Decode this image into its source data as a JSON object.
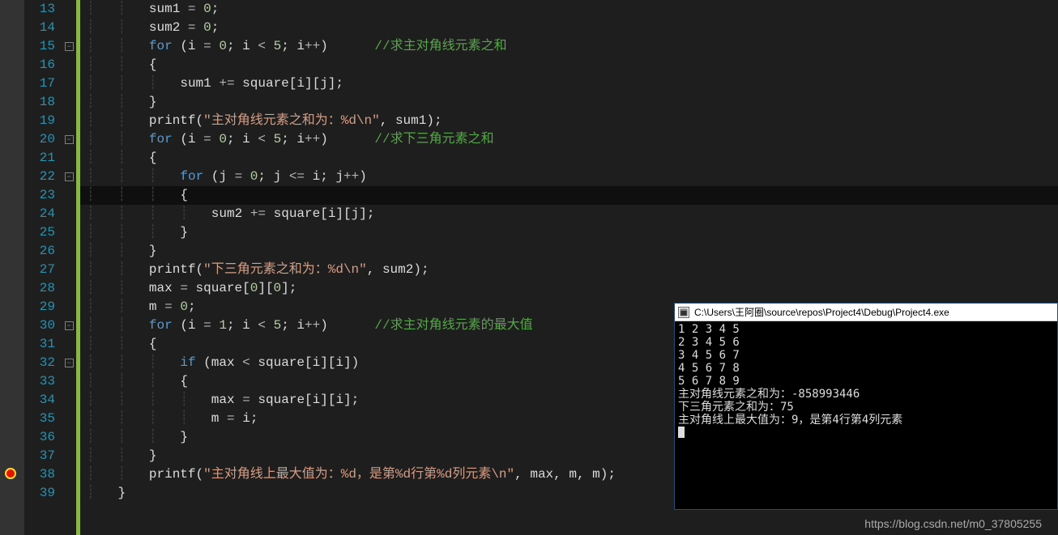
{
  "editor": {
    "lines": [
      {
        "num": 13,
        "fold": "",
        "html": "        sum1 <span class='op'>=</span> <span class='num'>0</span>;"
      },
      {
        "num": 14,
        "fold": "",
        "html": "        sum2 <span class='op'>=</span> <span class='num'>0</span>;"
      },
      {
        "num": 15,
        "fold": "box",
        "html": "        <span class='kw'>for</span> (i <span class='op'>=</span> <span class='num'>0</span>; i <span class='op'>&lt;</span> <span class='num'>5</span>; i<span class='op'>++</span>)      <span class='cmt'>//求主对角线元素之和</span>"
      },
      {
        "num": 16,
        "fold": "",
        "html": "        {"
      },
      {
        "num": 17,
        "fold": "",
        "html": "            sum1 <span class='op'>+=</span> square[i][j];"
      },
      {
        "num": 18,
        "fold": "",
        "html": "        }"
      },
      {
        "num": 19,
        "fold": "",
        "html": "        printf(<span class='str'>\"主对角线元素之和为：%d\\n\"</span>, sum1);"
      },
      {
        "num": 20,
        "fold": "box",
        "html": "        <span class='kw'>for</span> (i <span class='op'>=</span> <span class='num'>0</span>; i <span class='op'>&lt;</span> <span class='num'>5</span>; i<span class='op'>++</span>)      <span class='cmt'>//求下三角元素之和</span>"
      },
      {
        "num": 21,
        "fold": "",
        "html": "        {"
      },
      {
        "num": 22,
        "fold": "box",
        "html": "            <span class='kw'>for</span> (j <span class='op'>=</span> <span class='num'>0</span>; j <span class='op'>&lt;=</span> i; j<span class='op'>++</span>)"
      },
      {
        "num": 23,
        "fold": "",
        "cur": true,
        "html": "            {"
      },
      {
        "num": 24,
        "fold": "",
        "html": "                sum2 <span class='op'>+=</span> square[i][j];"
      },
      {
        "num": 25,
        "fold": "",
        "html": "            }"
      },
      {
        "num": 26,
        "fold": "",
        "html": "        }"
      },
      {
        "num": 27,
        "fold": "",
        "html": "        printf(<span class='str'>\"下三角元素之和为：%d\\n\"</span>, sum2);"
      },
      {
        "num": 28,
        "fold": "",
        "html": "        max <span class='op'>=</span> square[<span class='num'>0</span>][<span class='num'>0</span>];"
      },
      {
        "num": 29,
        "fold": "",
        "html": "        m <span class='op'>=</span> <span class='num'>0</span>;"
      },
      {
        "num": 30,
        "fold": "box",
        "html": "        <span class='kw'>for</span> (i <span class='op'>=</span> <span class='num'>1</span>; i <span class='op'>&lt;</span> <span class='num'>5</span>; i<span class='op'>++</span>)      <span class='cmt'>//求主对角线元素的最大值</span>"
      },
      {
        "num": 31,
        "fold": "",
        "html": "        {"
      },
      {
        "num": 32,
        "fold": "box",
        "html": "            <span class='kw'>if</span> (max <span class='op'>&lt;</span> square[i][i])"
      },
      {
        "num": 33,
        "fold": "",
        "html": "            {"
      },
      {
        "num": 34,
        "fold": "",
        "html": "                max <span class='op'>=</span> square[i][i];"
      },
      {
        "num": 35,
        "fold": "",
        "html": "                m <span class='op'>=</span> i;"
      },
      {
        "num": 36,
        "fold": "",
        "html": "            }"
      },
      {
        "num": 37,
        "fold": "",
        "html": "        }"
      },
      {
        "num": 38,
        "fold": "",
        "bp": true,
        "html": "        printf(<span class='str'>\"主对角线上最大值为：%d，是第%d行第%d列元素\\n\"</span>, max, m, m);"
      },
      {
        "num": 39,
        "fold": "",
        "html": "    }"
      }
    ]
  },
  "console": {
    "title": "C:\\Users\\王阿圈\\source\\repos\\Project4\\Debug\\Project4.exe",
    "output": "1 2 3 4 5\n2 3 4 5 6\n3 4 5 6 7\n4 5 6 7 8\n5 6 7 8 9\n主对角线元素之和为：-858993446\n下三角元素之和为：75\n主对角线上最大值为：9，是第4行第4列元素"
  },
  "watermark": "https://blog.csdn.net/m0_37805255"
}
